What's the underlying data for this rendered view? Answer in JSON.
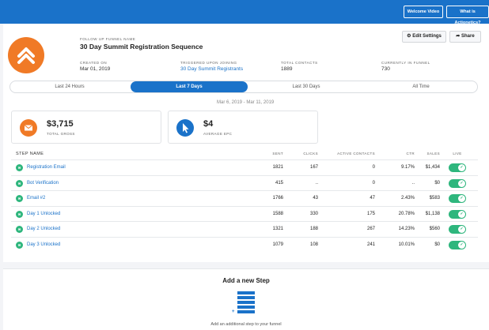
{
  "topbar": {
    "welcome_label": "Welcome Video",
    "actionetics_label": "What is Actionetics?"
  },
  "funnel": {
    "kicker": "FOLLOW UP FUNNEL NAME",
    "name": "30 Day Summit Registration Sequence",
    "logo_icon": "double-chevron-up-icon",
    "meta": [
      {
        "label": "CREATED ON",
        "value": "Mar 01, 2019"
      },
      {
        "label": "TRIGGERED UPON JOINING",
        "value": "30 Day Summit Registrants"
      },
      {
        "label": "TOTAL CONTACTS",
        "value": "1889"
      },
      {
        "label": "CURRENTLY IN FUNNEL",
        "value": "730"
      }
    ]
  },
  "actions": {
    "edit_label": "Edit Settings",
    "share_label": "Share"
  },
  "tabs": [
    {
      "label": "Last 24 Hours",
      "active": false
    },
    {
      "label": "Last 7 Days",
      "active": true
    },
    {
      "label": "Last 30 Days",
      "active": false
    },
    {
      "label": "All Time",
      "active": false
    }
  ],
  "date_range": "Mar 6, 2019 - Mar 11, 2019",
  "stats": [
    {
      "value": "$3,715",
      "label": "TOTAL GROSS",
      "icon": "envelope-icon",
      "color": "#f07a26"
    },
    {
      "value": "$4",
      "label": "AVERAGE EPC",
      "icon": "cursor-icon",
      "color": "#1a72c9"
    }
  ],
  "table": {
    "headers": [
      "STEP NAME",
      "SENT",
      "CLICKS",
      "ACTIVE CONTACTS",
      "CTR",
      "SALES",
      "LIVE"
    ],
    "rows": [
      {
        "name": "Registration Email",
        "sent": "1821",
        "clicks": "167",
        "active": "0",
        "ctr": "9.17%",
        "sales": "$1,434",
        "live": true
      },
      {
        "name": "Bot Verification",
        "sent": "415",
        "clicks": "..",
        "active": "0",
        "ctr": "..",
        "sales": "$0",
        "live": true
      },
      {
        "name": "Email #2",
        "sent": "1766",
        "clicks": "43",
        "active": "47",
        "ctr": "2.43%",
        "sales": "$583",
        "live": true
      },
      {
        "name": "Day 1 Unlocked",
        "sent": "1588",
        "clicks": "330",
        "active": "175",
        "ctr": "20.78%",
        "sales": "$1,138",
        "live": true
      },
      {
        "name": "Day 2 Unlocked",
        "sent": "1321",
        "clicks": "188",
        "active": "267",
        "ctr": "14.23%",
        "sales": "$560",
        "live": true
      },
      {
        "name": "Day 3 Unlocked",
        "sent": "1079",
        "clicks": "108",
        "active": "241",
        "ctr": "10.01%",
        "sales": "$0",
        "live": true
      }
    ]
  },
  "add_step": {
    "title": "Add a new Step",
    "subtitle": "Add an additional step to your funnel",
    "icon": "add-step-stack-icon"
  },
  "colors": {
    "primary": "#1a72c9",
    "accent": "#f07a26",
    "success": "#2eb67d"
  }
}
